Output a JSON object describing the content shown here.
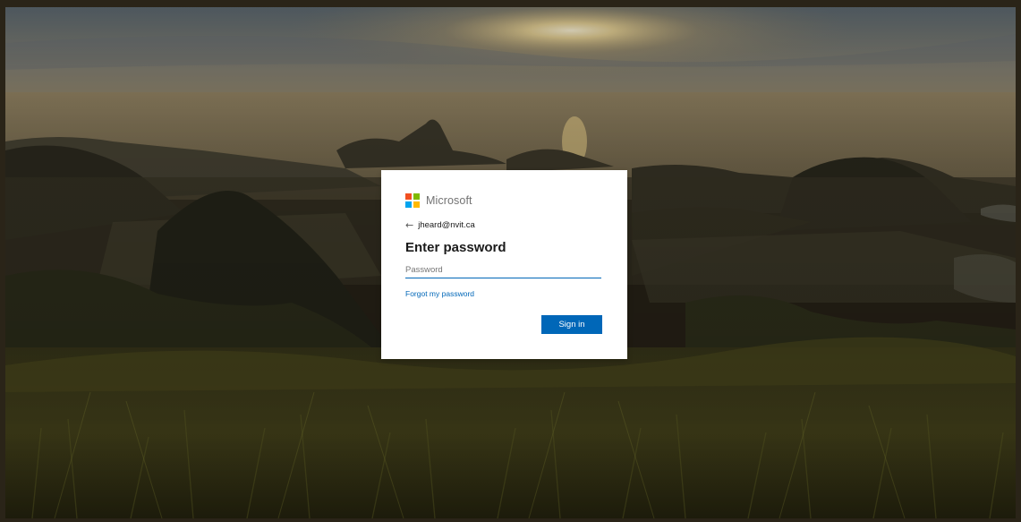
{
  "brand": {
    "name": "Microsoft",
    "logo_colors": [
      "#f25022",
      "#7fba00",
      "#00a4ef",
      "#ffb900"
    ]
  },
  "identity": {
    "back_icon": "arrow-left-icon",
    "email": "jheard@nvit.ca"
  },
  "form": {
    "title": "Enter password",
    "password_placeholder": "Password",
    "password_value": "",
    "forgot_link": "Forgot my password",
    "submit_label": "Sign in"
  },
  "colors": {
    "accent": "#0067b8",
    "dialog_bg": "#ffffff",
    "text_primary": "#1b1b1b",
    "text_muted": "#737373"
  }
}
